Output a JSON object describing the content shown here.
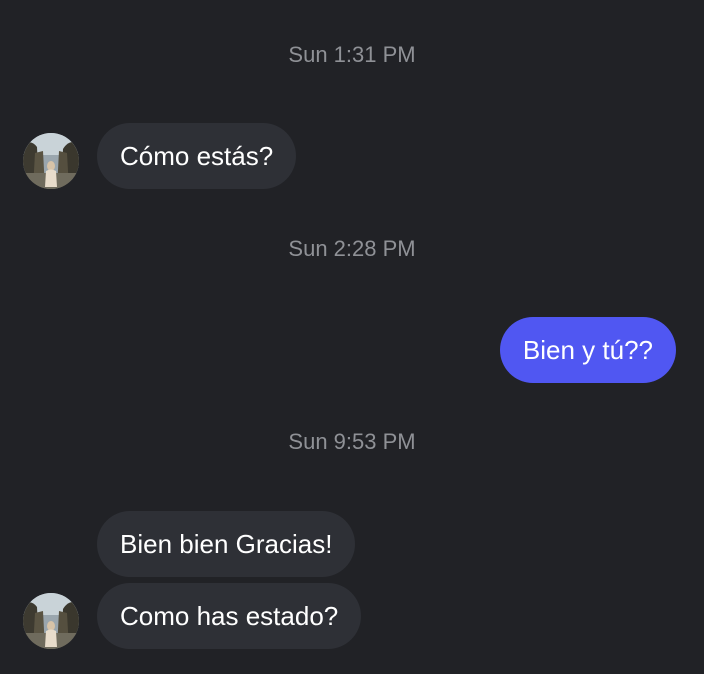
{
  "conversation": {
    "messages": [
      {
        "timestamp": "Sun 1:31 PM",
        "direction": "incoming",
        "text": "Cómo estás?"
      },
      {
        "timestamp": "Sun 2:28 PM",
        "direction": "outgoing",
        "text": "Bien y tú??"
      },
      {
        "timestamp": "Sun 9:53 PM",
        "direction": "incoming",
        "text": "Bien bien Gracias!"
      },
      {
        "direction": "incoming",
        "text": "Como has estado?"
      }
    ]
  },
  "colors": {
    "background": "#212226",
    "incoming_bubble": "#2e3036",
    "outgoing_bubble": "#5057f2",
    "timestamp_text": "#8f9196"
  },
  "icons": {
    "avatar": "contact-avatar-photo"
  }
}
